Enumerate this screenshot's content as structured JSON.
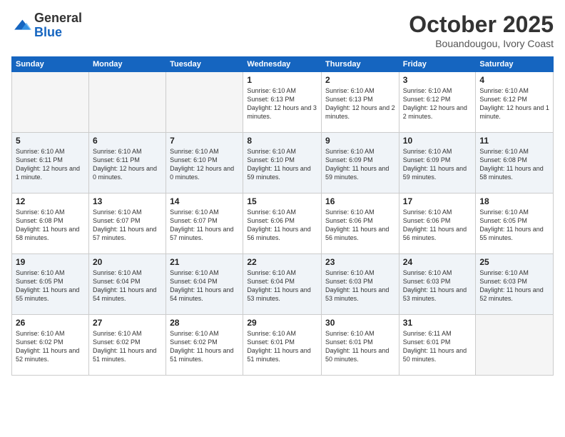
{
  "logo": {
    "general": "General",
    "blue": "Blue"
  },
  "title": "October 2025",
  "location": "Bouandougou, Ivory Coast",
  "days_header": [
    "Sunday",
    "Monday",
    "Tuesday",
    "Wednesday",
    "Thursday",
    "Friday",
    "Saturday"
  ],
  "weeks": [
    [
      {
        "num": "",
        "info": ""
      },
      {
        "num": "",
        "info": ""
      },
      {
        "num": "",
        "info": ""
      },
      {
        "num": "1",
        "info": "Sunrise: 6:10 AM\nSunset: 6:13 PM\nDaylight: 12 hours and 3 minutes."
      },
      {
        "num": "2",
        "info": "Sunrise: 6:10 AM\nSunset: 6:13 PM\nDaylight: 12 hours and 2 minutes."
      },
      {
        "num": "3",
        "info": "Sunrise: 6:10 AM\nSunset: 6:12 PM\nDaylight: 12 hours and 2 minutes."
      },
      {
        "num": "4",
        "info": "Sunrise: 6:10 AM\nSunset: 6:12 PM\nDaylight: 12 hours and 1 minute."
      }
    ],
    [
      {
        "num": "5",
        "info": "Sunrise: 6:10 AM\nSunset: 6:11 PM\nDaylight: 12 hours and 1 minute."
      },
      {
        "num": "6",
        "info": "Sunrise: 6:10 AM\nSunset: 6:11 PM\nDaylight: 12 hours and 0 minutes."
      },
      {
        "num": "7",
        "info": "Sunrise: 6:10 AM\nSunset: 6:10 PM\nDaylight: 12 hours and 0 minutes."
      },
      {
        "num": "8",
        "info": "Sunrise: 6:10 AM\nSunset: 6:10 PM\nDaylight: 11 hours and 59 minutes."
      },
      {
        "num": "9",
        "info": "Sunrise: 6:10 AM\nSunset: 6:09 PM\nDaylight: 11 hours and 59 minutes."
      },
      {
        "num": "10",
        "info": "Sunrise: 6:10 AM\nSunset: 6:09 PM\nDaylight: 11 hours and 59 minutes."
      },
      {
        "num": "11",
        "info": "Sunrise: 6:10 AM\nSunset: 6:08 PM\nDaylight: 11 hours and 58 minutes."
      }
    ],
    [
      {
        "num": "12",
        "info": "Sunrise: 6:10 AM\nSunset: 6:08 PM\nDaylight: 11 hours and 58 minutes."
      },
      {
        "num": "13",
        "info": "Sunrise: 6:10 AM\nSunset: 6:07 PM\nDaylight: 11 hours and 57 minutes."
      },
      {
        "num": "14",
        "info": "Sunrise: 6:10 AM\nSunset: 6:07 PM\nDaylight: 11 hours and 57 minutes."
      },
      {
        "num": "15",
        "info": "Sunrise: 6:10 AM\nSunset: 6:06 PM\nDaylight: 11 hours and 56 minutes."
      },
      {
        "num": "16",
        "info": "Sunrise: 6:10 AM\nSunset: 6:06 PM\nDaylight: 11 hours and 56 minutes."
      },
      {
        "num": "17",
        "info": "Sunrise: 6:10 AM\nSunset: 6:06 PM\nDaylight: 11 hours and 56 minutes."
      },
      {
        "num": "18",
        "info": "Sunrise: 6:10 AM\nSunset: 6:05 PM\nDaylight: 11 hours and 55 minutes."
      }
    ],
    [
      {
        "num": "19",
        "info": "Sunrise: 6:10 AM\nSunset: 6:05 PM\nDaylight: 11 hours and 55 minutes."
      },
      {
        "num": "20",
        "info": "Sunrise: 6:10 AM\nSunset: 6:04 PM\nDaylight: 11 hours and 54 minutes."
      },
      {
        "num": "21",
        "info": "Sunrise: 6:10 AM\nSunset: 6:04 PM\nDaylight: 11 hours and 54 minutes."
      },
      {
        "num": "22",
        "info": "Sunrise: 6:10 AM\nSunset: 6:04 PM\nDaylight: 11 hours and 53 minutes."
      },
      {
        "num": "23",
        "info": "Sunrise: 6:10 AM\nSunset: 6:03 PM\nDaylight: 11 hours and 53 minutes."
      },
      {
        "num": "24",
        "info": "Sunrise: 6:10 AM\nSunset: 6:03 PM\nDaylight: 11 hours and 53 minutes."
      },
      {
        "num": "25",
        "info": "Sunrise: 6:10 AM\nSunset: 6:03 PM\nDaylight: 11 hours and 52 minutes."
      }
    ],
    [
      {
        "num": "26",
        "info": "Sunrise: 6:10 AM\nSunset: 6:02 PM\nDaylight: 11 hours and 52 minutes."
      },
      {
        "num": "27",
        "info": "Sunrise: 6:10 AM\nSunset: 6:02 PM\nDaylight: 11 hours and 51 minutes."
      },
      {
        "num": "28",
        "info": "Sunrise: 6:10 AM\nSunset: 6:02 PM\nDaylight: 11 hours and 51 minutes."
      },
      {
        "num": "29",
        "info": "Sunrise: 6:10 AM\nSunset: 6:01 PM\nDaylight: 11 hours and 51 minutes."
      },
      {
        "num": "30",
        "info": "Sunrise: 6:10 AM\nSunset: 6:01 PM\nDaylight: 11 hours and 50 minutes."
      },
      {
        "num": "31",
        "info": "Sunrise: 6:11 AM\nSunset: 6:01 PM\nDaylight: 11 hours and 50 minutes."
      },
      {
        "num": "",
        "info": ""
      }
    ]
  ]
}
